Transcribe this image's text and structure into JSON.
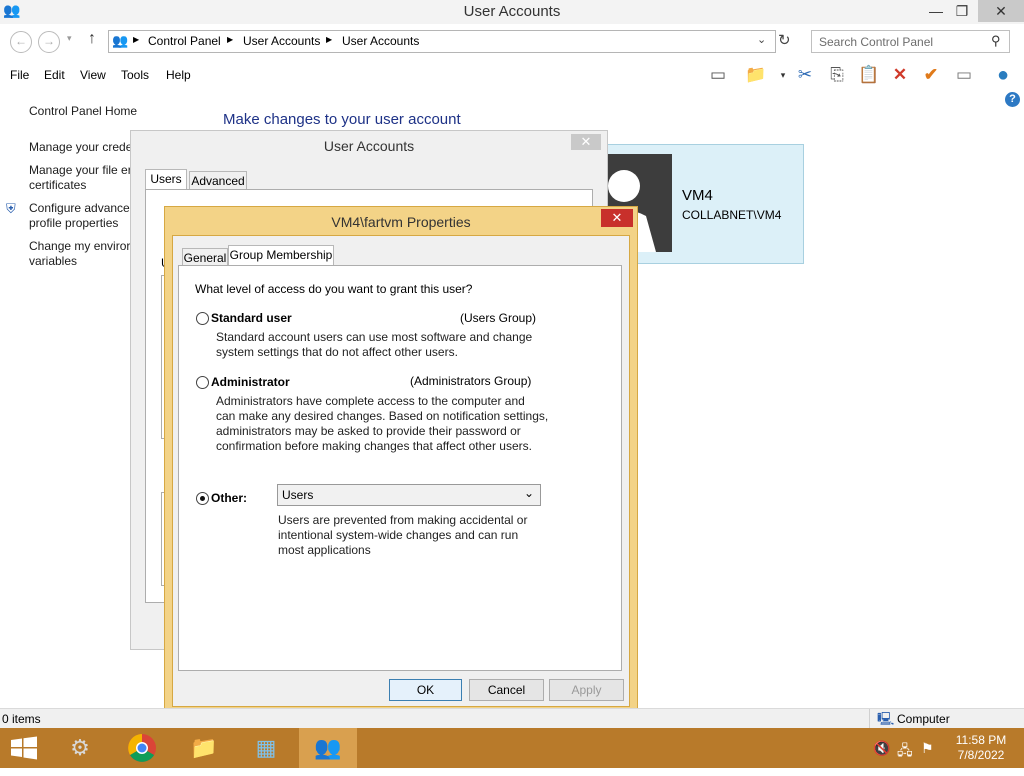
{
  "window": {
    "title": "User Accounts"
  },
  "address": {
    "crumbs": [
      "Control Panel",
      "User Accounts",
      "User Accounts"
    ],
    "search_placeholder": "Search Control Panel"
  },
  "menu": [
    "File",
    "Edit",
    "View",
    "Tools",
    "Help"
  ],
  "sidebar": {
    "home": "Control Panel Home",
    "links": [
      "Manage your crede",
      "Manage your file er",
      "certificates",
      "Configure advance",
      "profile properties",
      "Change my enviror",
      "variables"
    ]
  },
  "main": {
    "heading": "Make changes to your user account"
  },
  "user_panel": {
    "name": "VM4",
    "domain": "COLLABNET\\VM4"
  },
  "ua_dialog": {
    "title": "User Accounts",
    "tabs": [
      "Users",
      "Advanced"
    ],
    "partial_letter": "U"
  },
  "props_dialog": {
    "title": "VM4\\fartvm Properties",
    "tabs": [
      "General",
      "Group Membership"
    ],
    "question": "What level of access do you want to grant this user?",
    "standard": {
      "label": "Standard user",
      "group": "(Users Group)",
      "desc_1": "Standard account users can use most software and change",
      "desc_2": "system settings that do not affect other users."
    },
    "admin": {
      "label": "Administrator",
      "group": "(Administrators Group)",
      "desc_1": "Administrators have complete access to the computer and",
      "desc_2": "can make any desired changes. Based on notification settings,",
      "desc_3": "administrators may be asked to provide their password or",
      "desc_4": "confirmation before making changes that affect other users."
    },
    "other": {
      "label": "Other:",
      "selected": "Users",
      "desc_1": "Users are prevented from making accidental or",
      "desc_2": "intentional system-wide changes and can run",
      "desc_3": "most applications"
    },
    "buttons": {
      "ok": "OK",
      "cancel": "Cancel",
      "apply": "Apply"
    }
  },
  "status": {
    "items": "0 items",
    "location": "Computer"
  },
  "taskbar": {
    "time": "11:58 PM",
    "date": "7/8/2022"
  },
  "colors": {
    "accent": "#1e3287",
    "taskbar": "#b87a2a",
    "dialog_frame": "#f3d387",
    "close_red": "#c8302b"
  }
}
